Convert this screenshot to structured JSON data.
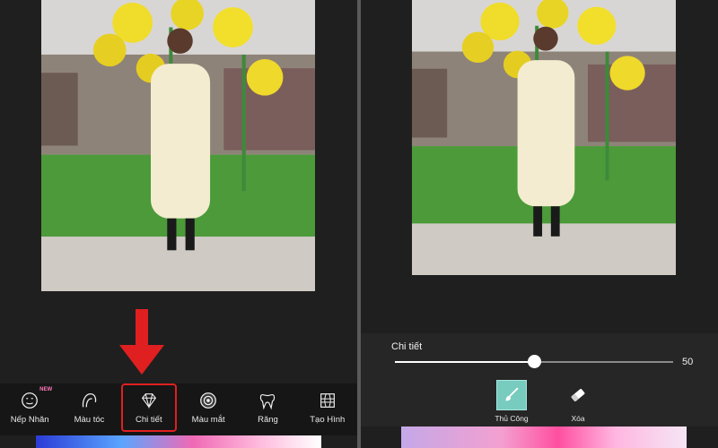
{
  "left": {
    "tools": [
      {
        "label": "Nếp Nhăn",
        "icon": "face-wrinkle-icon",
        "badge": "NEW"
      },
      {
        "label": "Màu tóc",
        "icon": "hair-color-icon"
      },
      {
        "label": "Chi tiết",
        "icon": "diamond-icon",
        "active": true
      },
      {
        "label": "Màu mắt",
        "icon": "eye-color-icon"
      },
      {
        "label": "Răng",
        "icon": "tooth-icon"
      },
      {
        "label": "Tạo Hình",
        "icon": "reshape-icon"
      }
    ]
  },
  "right": {
    "slider": {
      "title": "Chi tiết",
      "value": "50",
      "fraction": 0.5
    },
    "modes": [
      {
        "label": "Thủ Công",
        "icon": "brush-icon",
        "active": true
      },
      {
        "label": "Xóa",
        "icon": "eraser-icon"
      }
    ]
  },
  "colors": {
    "accent_red": "#e02020",
    "accent_teal": "#78cbbf"
  }
}
